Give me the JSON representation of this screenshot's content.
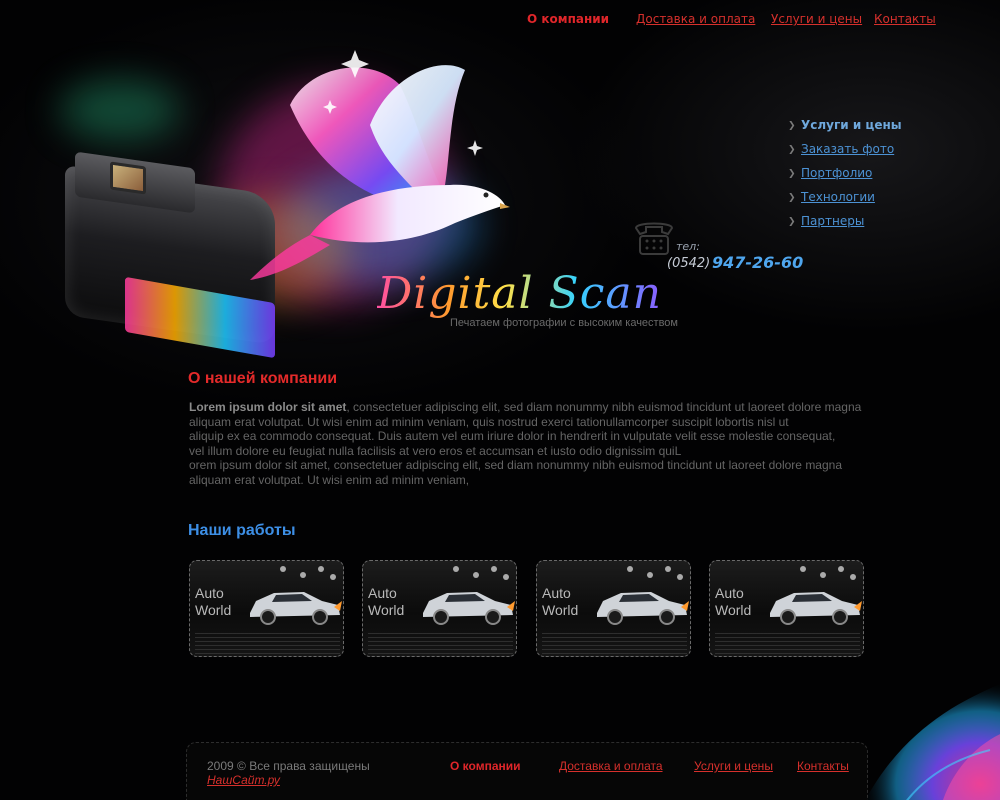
{
  "top_nav": {
    "items": [
      {
        "label": "О компании",
        "active": true
      },
      {
        "label": "Доставка и оплата",
        "active": false
      },
      {
        "label": "Услуги и цены",
        "active": false
      },
      {
        "label": "Контакты",
        "active": false
      }
    ]
  },
  "brand": {
    "title": "Digital Scan",
    "tagline": "Печатаем фотографии с высоким качеством"
  },
  "phone": {
    "label": "тел:",
    "code": "(0542)",
    "number": "947-26-60"
  },
  "side_menu": {
    "items": [
      {
        "label": "Услуги и цены",
        "active": true
      },
      {
        "label": "Заказать фото",
        "active": false
      },
      {
        "label": "Портфолио",
        "active": false
      },
      {
        "label": "Технологии",
        "active": false
      },
      {
        "label": "Партнеры",
        "active": false
      }
    ]
  },
  "about": {
    "title": "О нашей компании",
    "lead": "Lorem ipsum dolor sit amet",
    "line1": ", consectetuer adipiscing elit, sed diam nonummy nibh euismod tincidunt ut laoreet dolore magna",
    "line2": "aliquam erat volutpat. Ut wisi enim ad minim veniam, quis nostrud exerci tationullamcorper suscipit lobortis nisl ut",
    "line3": "aliquip ex ea commodo consequat. Duis autem vel eum iriure dolor in hendrerit in vulputate velit esse molestie consequat,",
    "line4": "vel illum dolore eu feugiat nulla facilisis at vero eros et accumsan et iusto odio dignissim quiL",
    "line5": "orem ipsum dolor sit amet, consectetuer adipiscing elit, sed diam nonummy nibh euismod tincidunt ut laoreet dolore magna",
    "line6": "aliquam erat volutpat. Ut wisi enim ad minim veniam,"
  },
  "works": {
    "title": "Наши работы",
    "items": [
      {
        "line1": "Auto",
        "line2": "World"
      },
      {
        "line1": "Auto",
        "line2": "World"
      },
      {
        "line1": "Auto",
        "line2": "World"
      },
      {
        "line1": "Auto",
        "line2": "World"
      }
    ]
  },
  "footer": {
    "copyright": "2009 © Все права защищены",
    "site": "НашСайт.ру",
    "nav": [
      {
        "label": "О компании",
        "active": true
      },
      {
        "label": "Доставка и оплата",
        "active": false
      },
      {
        "label": "Услуги и цены",
        "active": false
      },
      {
        "label": "Контакты",
        "active": false
      }
    ]
  },
  "colors": {
    "accent_red": "#e0262a",
    "accent_blue": "#3d8fe6",
    "background": "#000000"
  }
}
